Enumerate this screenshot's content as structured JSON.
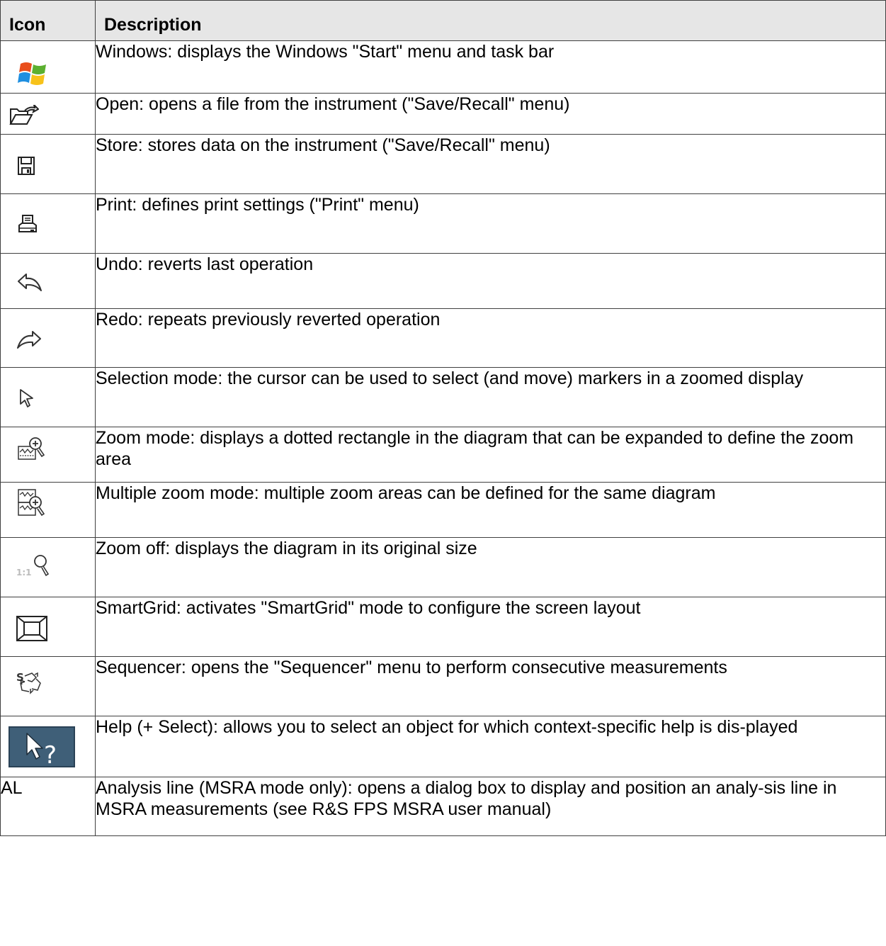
{
  "table": {
    "header_icon": "Icon",
    "header_description": "Description",
    "rows": [
      {
        "icon": "windows-logo-icon",
        "description": "Windows: displays the Windows \"Start\" menu and task bar"
      },
      {
        "icon": "open-folder-icon",
        "description": "Open: opens a file from the instrument (\"Save/Recall\" menu)"
      },
      {
        "icon": "floppy-disk-icon",
        "description": "Store: stores data on the instrument (\"Save/Recall\" menu)"
      },
      {
        "icon": "printer-icon",
        "description": "Print: defines print settings (\"Print\" menu)"
      },
      {
        "icon": "undo-arrow-icon",
        "description": "Undo: reverts last operation"
      },
      {
        "icon": "redo-arrow-icon",
        "description": "Redo: repeats previously reverted operation"
      },
      {
        "icon": "cursor-arrow-icon",
        "description": "Selection mode: the cursor can be used to select (and move) markers in a zoomed display"
      },
      {
        "icon": "zoom-mode-icon",
        "description": "Zoom mode: displays a dotted rectangle in the diagram that can be expanded to define the zoom area"
      },
      {
        "icon": "multiple-zoom-icon",
        "description": "Multiple zoom mode: multiple zoom areas can be defined for the same diagram"
      },
      {
        "icon": "zoom-off-icon",
        "icon_text": "1:1",
        "description": "Zoom off: displays the diagram in its original size"
      },
      {
        "icon": "smartgrid-icon",
        "description": "SmartGrid: activates \"SmartGrid\" mode to configure the screen layout"
      },
      {
        "icon": "sequencer-icon",
        "icon_text": "S",
        "description": "Sequencer: opens the \"Sequencer\" menu to perform consecutive measurements"
      },
      {
        "icon": "help-select-icon",
        "icon_text": "?",
        "description": "Help (+ Select): allows you to select an object for which context-specific help is dis-played"
      },
      {
        "icon_label": "AL",
        "description": "Analysis line (MSRA mode only): opens a dialog box to display and position an analy-sis line in MSRA measurements (see R&S FPS MSRA user manual)"
      }
    ]
  }
}
